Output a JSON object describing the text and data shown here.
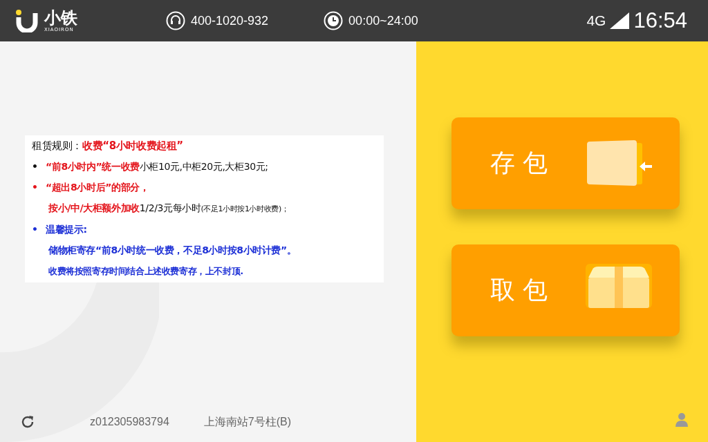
{
  "header": {
    "brand": "小铁",
    "brand_sub": "XIAOIRON",
    "phone": "400-1020-932",
    "hours": "00:00~24:00",
    "network": "4G",
    "time": "16:54"
  },
  "notice": {
    "lines": [
      {
        "indent": false,
        "segments": [
          {
            "text": "租赁规则：",
            "kind": "plain",
            "color": "#111111"
          },
          {
            "text": "收费“8小时收费起租”",
            "kind": "strong",
            "color": "#e4141b"
          }
        ]
      },
      {
        "bullet": {
          "text": "•",
          "color": "#111111"
        },
        "indent": false,
        "segments": [
          {
            "text": "“前8小时内”统一收费",
            "kind": "strong",
            "color": "#e4141b"
          },
          {
            "text": "小柜10元,中柜20元,大柜30元;",
            "kind": "plain",
            "color": "#111111"
          }
        ]
      },
      {
        "bullet": {
          "text": "•",
          "color": "#e4141b"
        },
        "indent": false,
        "segments": [
          {
            "text": "“超出8小时后”的部分，",
            "kind": "strong",
            "color": "#e4141b"
          }
        ]
      },
      {
        "indent": true,
        "segments": [
          {
            "text": "按小/中/大柜额外加收",
            "kind": "strong",
            "color": "#e4141b"
          },
          {
            "text": "1/2/3元每小时",
            "kind": "plain",
            "color": "#111111"
          },
          {
            "text": "(不足1小时按1小时收费)；",
            "kind": "note",
            "color": "#111111"
          }
        ]
      },
      {
        "bullet": {
          "text": "•",
          "color": "#1c2fd6"
        },
        "indent": false,
        "segments": [
          {
            "text": "温馨提示:",
            "kind": "strong",
            "color": "#1c2fd6"
          }
        ]
      },
      {
        "indent": true,
        "segments": [
          {
            "text": "储物柜寄存“前8小时统一收费，不足8小时按8小时计费”。",
            "kind": "strong",
            "color": "#1c2fd6"
          }
        ]
      },
      {
        "indent": true,
        "segments": [
          {
            "text": "收费将按照寄存时间结合上述收费寄存，上不封顶.",
            "kind": "strongnote",
            "color": "#1c2fd6"
          }
        ]
      }
    ]
  },
  "actions": [
    {
      "label": "存 包",
      "kind": "deposit"
    },
    {
      "label": "取 包",
      "kind": "pickup"
    }
  ],
  "footer": {
    "device_id": "z012305983794",
    "location": "上海南站7号柱(B)"
  }
}
